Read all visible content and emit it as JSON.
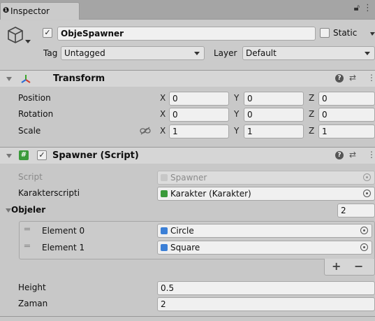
{
  "tab": {
    "title": "Inspector",
    "info_icon": "info-icon"
  },
  "header": {
    "object_name": "ObjeSpawner",
    "active_checked": true,
    "static_label": "Static",
    "tag_label": "Tag",
    "tag_value": "Untagged",
    "layer_label": "Layer",
    "layer_value": "Default"
  },
  "transform": {
    "title": "Transform",
    "rows": [
      {
        "label": "Position",
        "x": "0",
        "y": "0",
        "z": "0"
      },
      {
        "label": "Rotation",
        "x": "0",
        "y": "0",
        "z": "0"
      },
      {
        "label": "Scale",
        "x": "1",
        "y": "1",
        "z": "1"
      }
    ],
    "axis_x": "X",
    "axis_y": "Y",
    "axis_z": "Z"
  },
  "spawner": {
    "title": "Spawner (Script)",
    "enabled": true,
    "script_label": "Script",
    "script_value": "Spawner",
    "karakter_label": "Karakterscripti",
    "karakter_value": "Karakter (Karakter)",
    "objeler_label": "Objeler",
    "objeler_count": "2",
    "elements": [
      {
        "label": "Element 0",
        "value": "Circle"
      },
      {
        "label": "Element 1",
        "value": "Square"
      }
    ],
    "plus": "+",
    "minus": "−",
    "height_label": "Height",
    "height_value": "0.5",
    "zaman_label": "Zaman",
    "zaman_value": "2"
  },
  "colors": {
    "script_icon": "#3a9a3a",
    "prefab_icon": "#3b7fd6",
    "transform_red": "#d43b2a",
    "transform_green": "#3aa52a",
    "transform_blue": "#2a6bd4"
  }
}
